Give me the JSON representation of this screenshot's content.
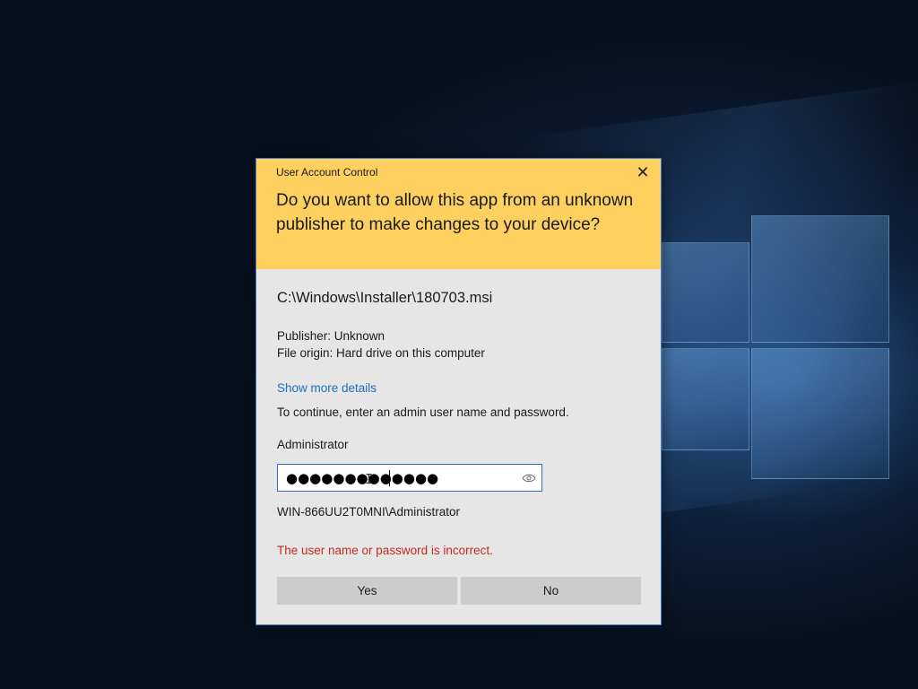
{
  "dialog": {
    "title": "User Account Control",
    "close_icon": "close-icon",
    "question": "Do you want to allow this app from an unknown publisher to make changes to your device?",
    "app_path": "C:\\Windows\\Installer\\180703.msi",
    "publisher": "Publisher: Unknown",
    "file_origin": "File origin: Hard drive on this computer",
    "details_link": "Show more details",
    "instruction": "To continue, enter an admin user name and password.",
    "username_label": "Administrator",
    "password": {
      "masked_value": "●●●●●●●●●●●●●",
      "reveal_icon": "eye-icon"
    },
    "account": "WIN-866UU2T0MNI\\Administrator",
    "error": "The user name or password is incorrect.",
    "yes_label": "Yes",
    "no_label": "No"
  },
  "colors": {
    "header": "#fdd060",
    "body": "#e6e6e6",
    "link": "#1a6fc0",
    "error": "#c42b1c",
    "button": "#cccccc",
    "border_accent": "#2d6cc0"
  }
}
